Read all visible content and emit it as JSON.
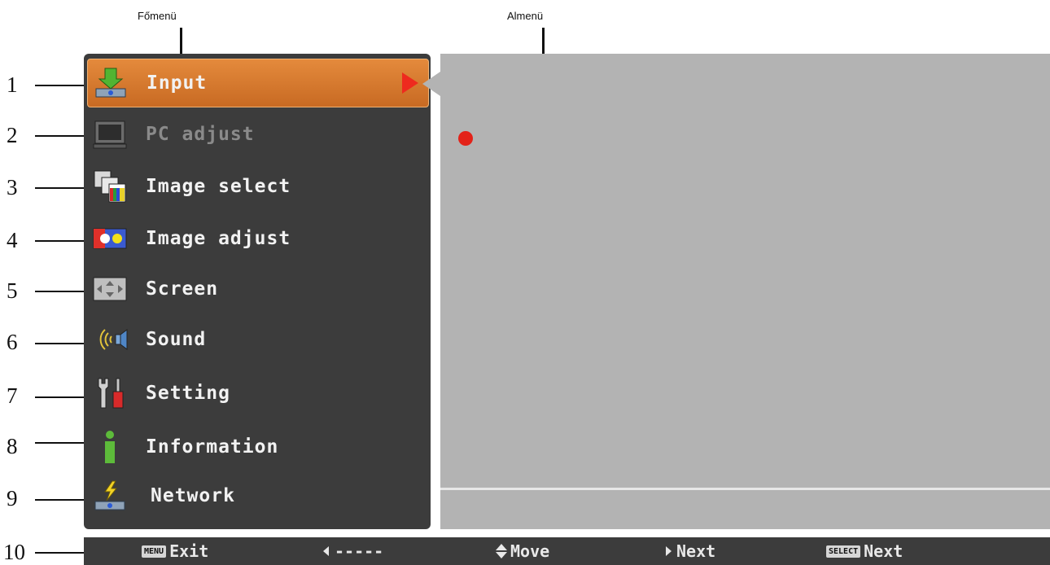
{
  "callouts": {
    "main_menu": "Főmenü",
    "sub_menu": "Almenü"
  },
  "numbers": [
    "1",
    "2",
    "3",
    "4",
    "5",
    "6",
    "7",
    "8",
    "9",
    "10"
  ],
  "menu": {
    "items": [
      {
        "label": "Input",
        "icon": "input-icon",
        "selected": true,
        "disabled": false
      },
      {
        "label": "PC adjust",
        "icon": "pc-adjust-icon",
        "selected": false,
        "disabled": true
      },
      {
        "label": "Image select",
        "icon": "image-select-icon",
        "selected": false,
        "disabled": false
      },
      {
        "label": "Image adjust",
        "icon": "image-adjust-icon",
        "selected": false,
        "disabled": false
      },
      {
        "label": "Screen",
        "icon": "screen-icon",
        "selected": false,
        "disabled": false
      },
      {
        "label": "Sound",
        "icon": "sound-icon",
        "selected": false,
        "disabled": false
      },
      {
        "label": "Setting",
        "icon": "setting-icon",
        "selected": false,
        "disabled": false
      },
      {
        "label": "Information",
        "icon": "information-icon",
        "selected": false,
        "disabled": false
      },
      {
        "label": "Network",
        "icon": "network-icon",
        "selected": false,
        "disabled": false
      }
    ]
  },
  "status_bar": {
    "exit_key": "MENU",
    "exit_label": "Exit",
    "back_label": "-----",
    "move_label": "Move",
    "next_label": "Next",
    "select_key": "SELECT",
    "select_next_label": "Next"
  },
  "colors": {
    "panel": "#3c3c3c",
    "submenu": "#b3b3b3",
    "selected": "#d9782e",
    "accent_red": "#e32219"
  }
}
